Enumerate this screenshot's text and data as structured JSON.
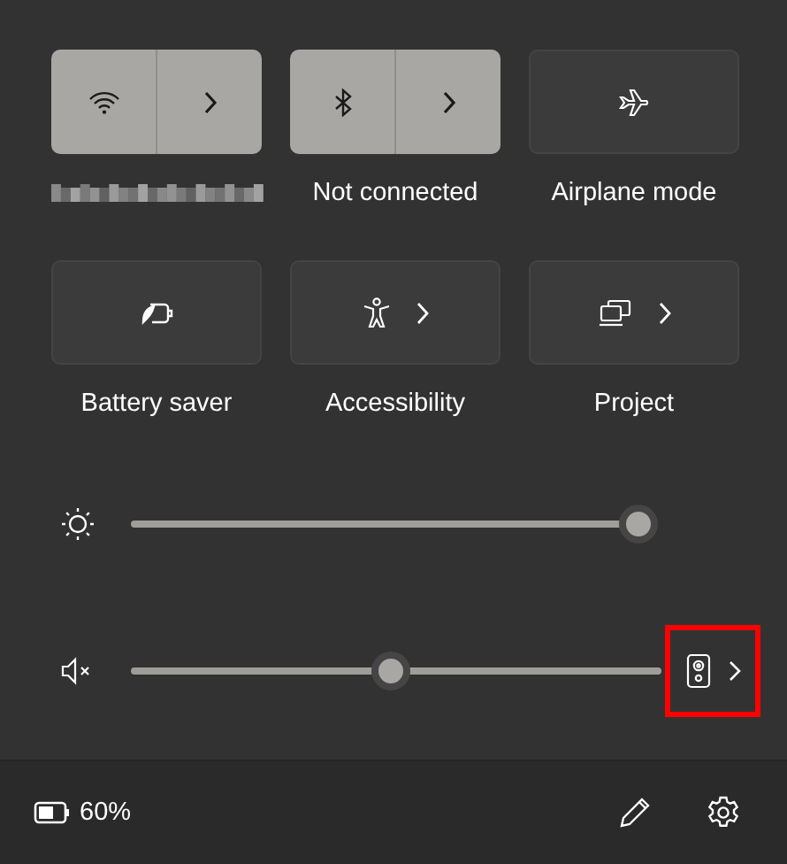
{
  "tiles": [
    {
      "kind": "split",
      "on": true,
      "label_redacted": true
    },
    {
      "kind": "split",
      "on": true,
      "label": "Not connected"
    },
    {
      "kind": "plain",
      "on": false,
      "label": "Airplane mode"
    },
    {
      "kind": "plain",
      "on": false,
      "label": "Battery saver"
    },
    {
      "kind": "chevron",
      "on": false,
      "label": "Accessibility"
    },
    {
      "kind": "chevron",
      "on": false,
      "label": "Project"
    }
  ],
  "brightness": {
    "level": 0.99
  },
  "volume": {
    "level": 0.49,
    "muted": true,
    "output_highlighted": true
  },
  "footer": {
    "battery": "60%"
  }
}
